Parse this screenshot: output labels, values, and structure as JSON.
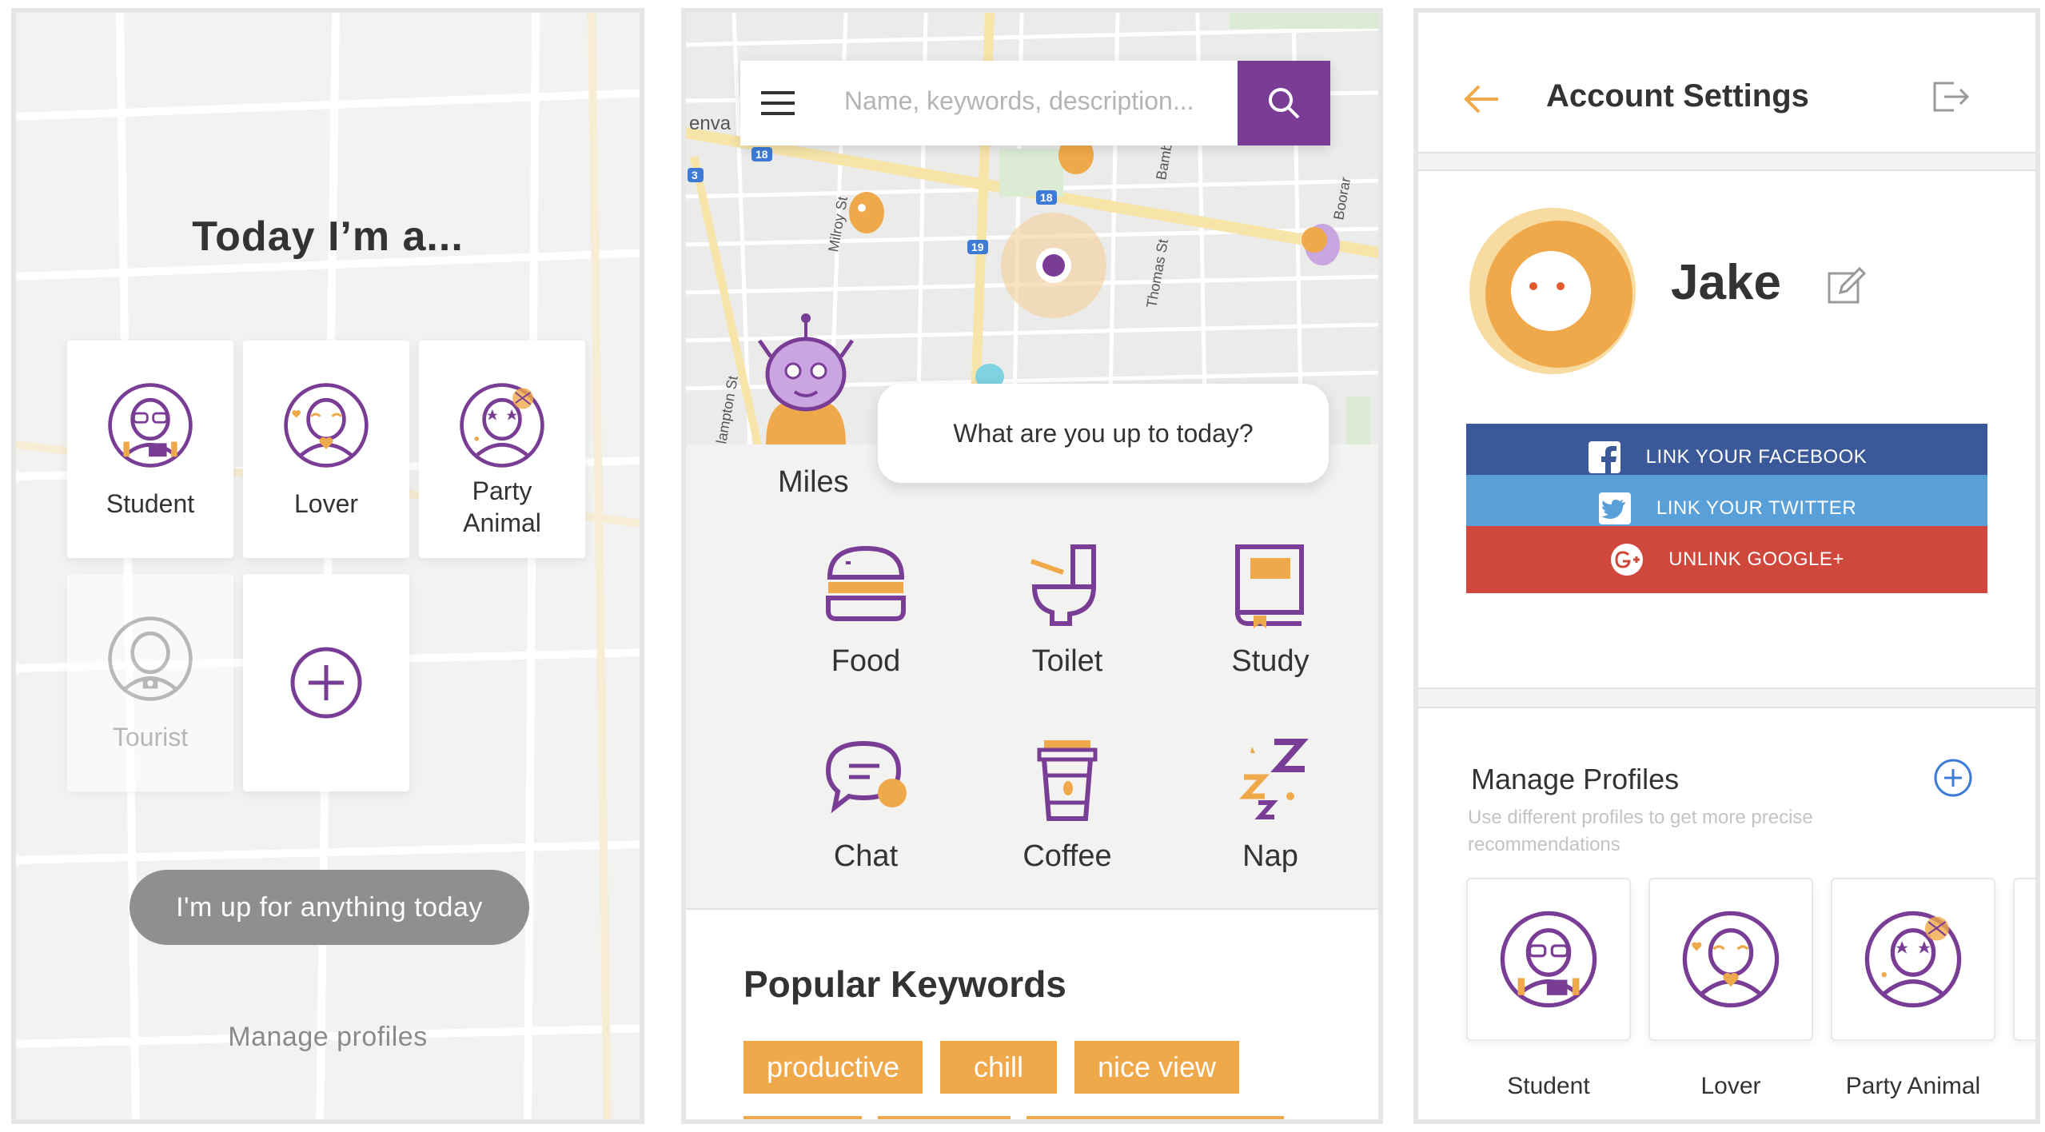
{
  "colors": {
    "purple": "#7a3d96",
    "orange": "#f0a94a",
    "facebook": "#3b5998",
    "twitter": "#5aa0d8",
    "google": "#d0473b"
  },
  "screen1": {
    "title": "Today I’m a...",
    "cards": [
      {
        "label": "Student",
        "icon": "student-avatar-icon"
      },
      {
        "label": "Lover",
        "icon": "lover-avatar-icon"
      },
      {
        "label": "Party\nAnimal",
        "icon": "party-animal-avatar-icon"
      },
      {
        "label": "Tourist",
        "icon": "tourist-avatar-icon",
        "disabled": true
      },
      {
        "label": "",
        "icon": "add-icon"
      }
    ],
    "anything_button": "I'm up for anything today",
    "manage_link": "Manage profiles"
  },
  "screen2": {
    "search_placeholder": "Name, keywords, description...",
    "map": {
      "streets": [
        "Milroy St",
        "Thomas St",
        "Bamb",
        "Boorar",
        "lampton St",
        "enva"
      ],
      "route_badges": [
        "18",
        "18",
        "19",
        "3"
      ]
    },
    "bubble_text": "What are you up to today?",
    "character_name": "Miles",
    "categories": [
      {
        "label": "Food",
        "icon": "burger-icon"
      },
      {
        "label": "Toilet",
        "icon": "toilet-icon"
      },
      {
        "label": "Study",
        "icon": "book-icon"
      },
      {
        "label": "Chat",
        "icon": "chat-icon"
      },
      {
        "label": "Coffee",
        "icon": "coffee-cup-icon"
      },
      {
        "label": "Nap",
        "icon": "sleep-icon"
      }
    ],
    "popular_title": "Popular Keywords",
    "keywords": [
      "productive",
      "chill",
      "nice view"
    ]
  },
  "screen3": {
    "title": "Account Settings",
    "user_name": "Jake",
    "facebook_label": "LINK YOUR FACEBOOK",
    "twitter_label": "LINK YOUR TWITTER",
    "google_label": "UNLINK GOOGLE+",
    "manage_title": "Manage Profiles",
    "manage_subtitle": "Use different profiles to get more precise recommendations",
    "profiles": [
      {
        "label": "Student"
      },
      {
        "label": "Lover"
      },
      {
        "label": "Party Animal"
      }
    ]
  }
}
